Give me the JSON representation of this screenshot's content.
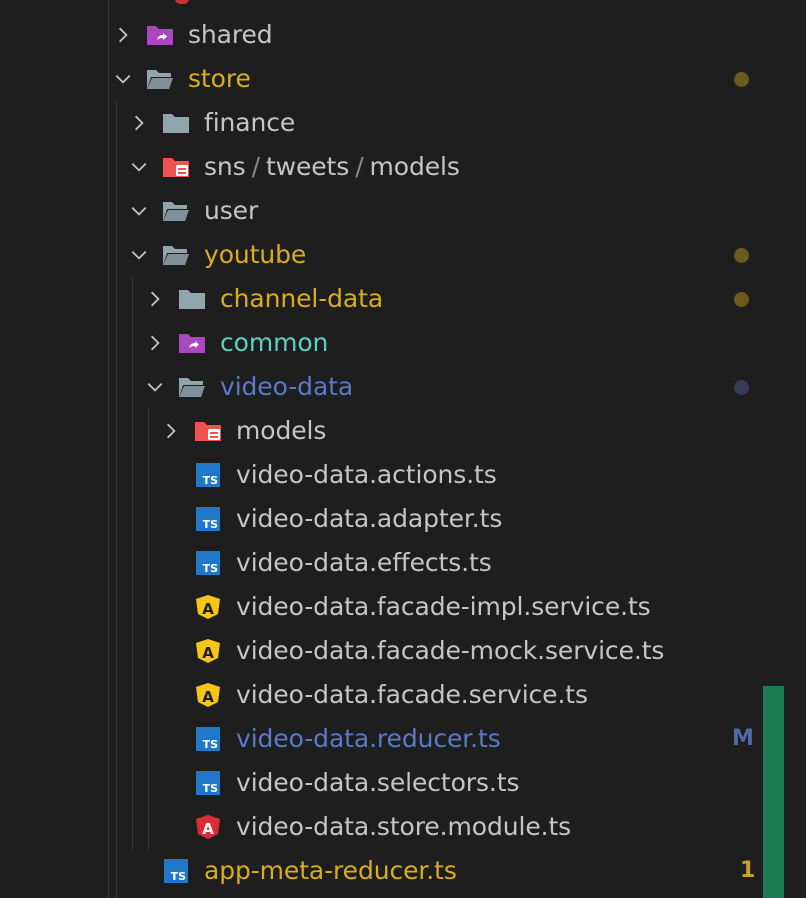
{
  "tree": [
    {
      "id": "shared",
      "segments": [
        "shared"
      ],
      "depth": 0,
      "expandable": true,
      "expanded": false,
      "icon": "folder-shared-icon",
      "color": "default",
      "indicator": null
    },
    {
      "id": "store",
      "segments": [
        "store"
      ],
      "depth": 0,
      "expandable": true,
      "expanded": true,
      "icon": "folder-open-icon",
      "color": "modified",
      "indicator": {
        "type": "dot",
        "color": "#6b5a1e"
      }
    },
    {
      "id": "finance",
      "segments": [
        "finance"
      ],
      "depth": 1,
      "expandable": true,
      "expanded": false,
      "icon": "folder-icon",
      "color": "default",
      "indicator": null
    },
    {
      "id": "sns-tweets-models",
      "segments": [
        "sns",
        "tweets",
        "models"
      ],
      "depth": 1,
      "expandable": true,
      "expanded": true,
      "icon": "folder-models-icon",
      "color": "default",
      "indicator": null
    },
    {
      "id": "user",
      "segments": [
        "user"
      ],
      "depth": 1,
      "expandable": true,
      "expanded": true,
      "icon": "folder-open-icon",
      "color": "default",
      "indicator": null
    },
    {
      "id": "youtube",
      "segments": [
        "youtube"
      ],
      "depth": 1,
      "expandable": true,
      "expanded": true,
      "icon": "folder-open-icon",
      "color": "modified",
      "indicator": {
        "type": "dot",
        "color": "#6b5a1e"
      }
    },
    {
      "id": "channel-data",
      "segments": [
        "channel-data"
      ],
      "depth": 2,
      "expandable": true,
      "expanded": false,
      "icon": "folder-icon",
      "color": "modified",
      "indicator": {
        "type": "dot",
        "color": "#6b5a1e"
      }
    },
    {
      "id": "common",
      "segments": [
        "common"
      ],
      "depth": 2,
      "expandable": true,
      "expanded": false,
      "icon": "folder-shared-icon",
      "color": "cyan",
      "indicator": null
    },
    {
      "id": "video-data",
      "segments": [
        "video-data"
      ],
      "depth": 2,
      "expandable": true,
      "expanded": true,
      "icon": "folder-open-icon",
      "color": "blue",
      "indicator": {
        "type": "dot",
        "color": "#343c57"
      }
    },
    {
      "id": "models",
      "segments": [
        "models"
      ],
      "depth": 3,
      "expandable": true,
      "expanded": false,
      "icon": "folder-models-icon",
      "color": "default",
      "indicator": null
    },
    {
      "id": "actions",
      "segments": [
        "video-data.actions.ts"
      ],
      "depth": 3,
      "expandable": false,
      "icon": "typescript-icon",
      "color": "default",
      "indicator": null
    },
    {
      "id": "adapter",
      "segments": [
        "video-data.adapter.ts"
      ],
      "depth": 3,
      "expandable": false,
      "icon": "typescript-icon",
      "color": "default",
      "indicator": null
    },
    {
      "id": "effects",
      "segments": [
        "video-data.effects.ts"
      ],
      "depth": 3,
      "expandable": false,
      "icon": "typescript-icon",
      "color": "default",
      "indicator": null
    },
    {
      "id": "facade-impl",
      "segments": [
        "video-data.facade-impl.service.ts"
      ],
      "depth": 3,
      "expandable": false,
      "icon": "angular-service-icon",
      "color": "default",
      "indicator": null
    },
    {
      "id": "facade-mock",
      "segments": [
        "video-data.facade-mock.service.ts"
      ],
      "depth": 3,
      "expandable": false,
      "icon": "angular-service-icon",
      "color": "default",
      "indicator": null
    },
    {
      "id": "facade",
      "segments": [
        "video-data.facade.service.ts"
      ],
      "depth": 3,
      "expandable": false,
      "icon": "angular-service-icon",
      "color": "default",
      "indicator": null
    },
    {
      "id": "reducer",
      "segments": [
        "video-data.reducer.ts"
      ],
      "depth": 3,
      "expandable": false,
      "icon": "typescript-icon",
      "color": "blue",
      "indicator": {
        "type": "badge",
        "text": "M",
        "color": "#4f6aa8"
      }
    },
    {
      "id": "selectors",
      "segments": [
        "video-data.selectors.ts"
      ],
      "depth": 3,
      "expandable": false,
      "icon": "typescript-icon",
      "color": "default",
      "indicator": null
    },
    {
      "id": "store-module",
      "segments": [
        "video-data.store.module.ts"
      ],
      "depth": 3,
      "expandable": false,
      "icon": "angular-module-icon",
      "color": "default",
      "indicator": null
    },
    {
      "id": "app-meta-reducer",
      "segments": [
        "app-meta-reducer.ts"
      ],
      "depth": 1,
      "expandable": false,
      "icon": "typescript-icon",
      "color": "modified",
      "indicator": {
        "type": "badge",
        "text": "1",
        "color": "#c9a227"
      }
    }
  ],
  "colors": {
    "background": "#1e1e1e",
    "default": "#c5c5c5",
    "modified": "#d9ac23",
    "cyan": "#5fd0c0",
    "blue": "#5b79c6",
    "folder": "#90a4ae",
    "shared_folder": "#ab47bc",
    "models_folder": "#ef5350",
    "typescript": "#1f78c8",
    "angular_service": "#f5c518",
    "angular_module": "#dd2c35",
    "scroll_indicator": "#1f7a56"
  }
}
